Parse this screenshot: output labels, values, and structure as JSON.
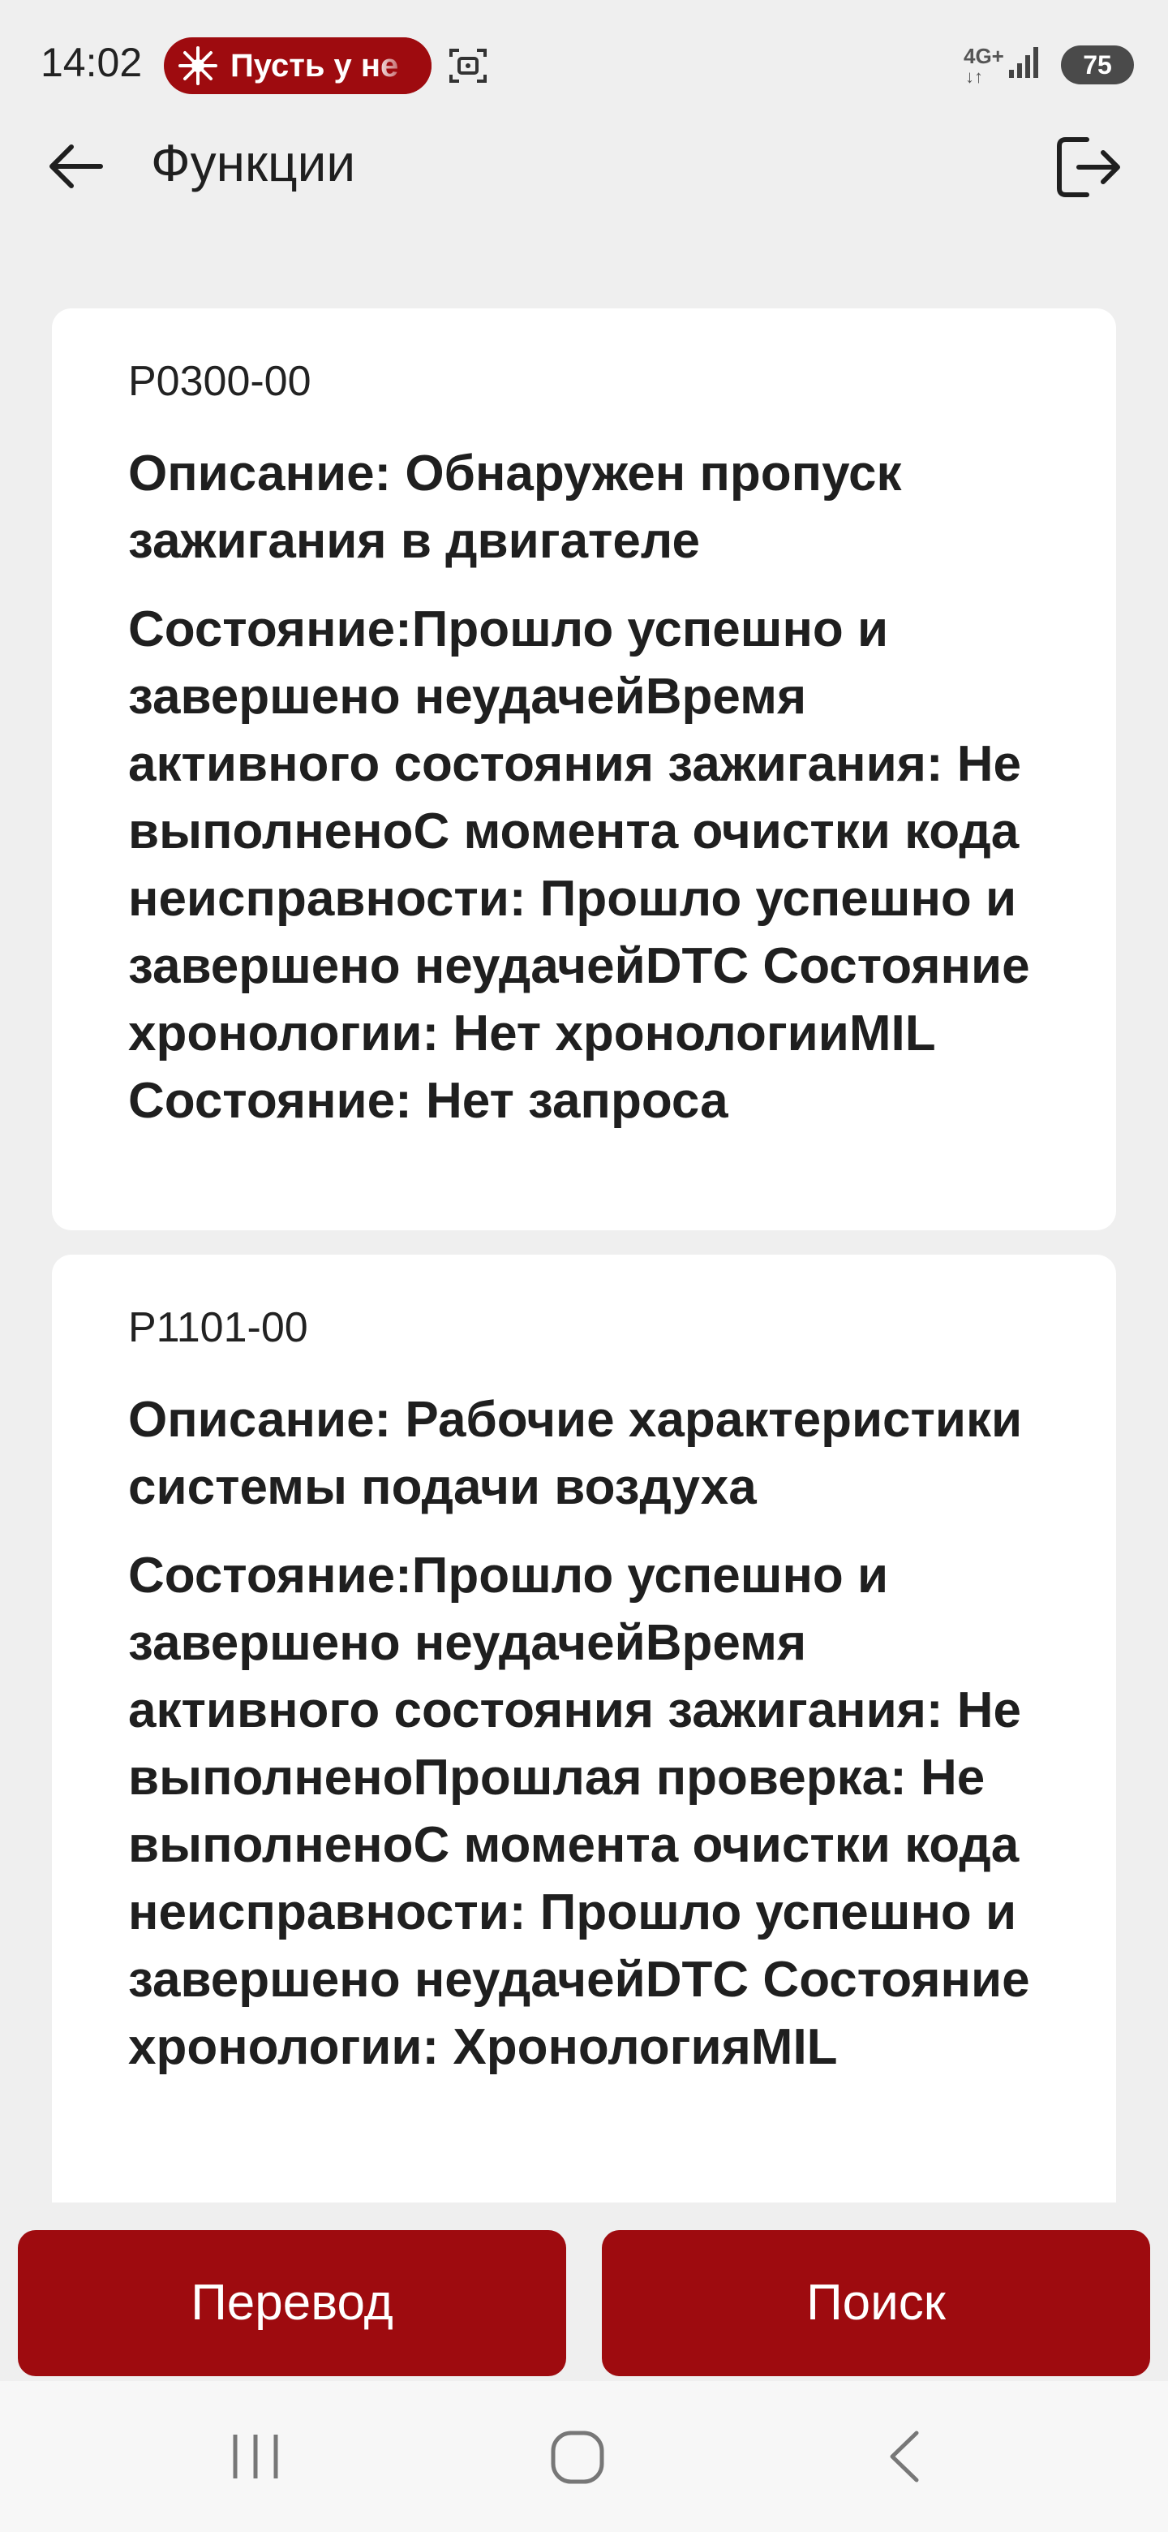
{
  "status_bar": {
    "time": "14:02",
    "notification_text": "Пусть у не",
    "network": "4G+",
    "network_arrows": "↓↑",
    "battery": "75",
    "accent_color": "#9e0b0f"
  },
  "app_bar": {
    "title": "Функции",
    "back_icon": "arrow-left-icon",
    "logout_icon": "logout-icon"
  },
  "cards": [
    {
      "code": "P0300-00",
      "description": "Описание: Обнаружен пропуск зажигания в двигателе",
      "state": "Состояние:Прошло успешно и завершено неудачейВремя активного состояния зажигания: Не выполненоС момента очистки кода неисправности: Прошло успешно и завершено неудачейDTC Состояние хронологии: Нет хронологииMIL Состояние: Нет запроса"
    },
    {
      "code": "P1101-00",
      "description": "Описание: Рабочие характеристики системы подачи воздуха",
      "state": "Состояние:Прошло успешно и завершено неудачейВремя активного состояния зажигания: Не выполненоПрошлая проверка: Не выполненоС момента очистки кода неисправности: Прошло успешно и завершено неудачейDTC Состояние хронологии: ХронологияMIL"
    }
  ],
  "actions": {
    "translate_label": "Перевод",
    "search_label": "Поиск"
  }
}
